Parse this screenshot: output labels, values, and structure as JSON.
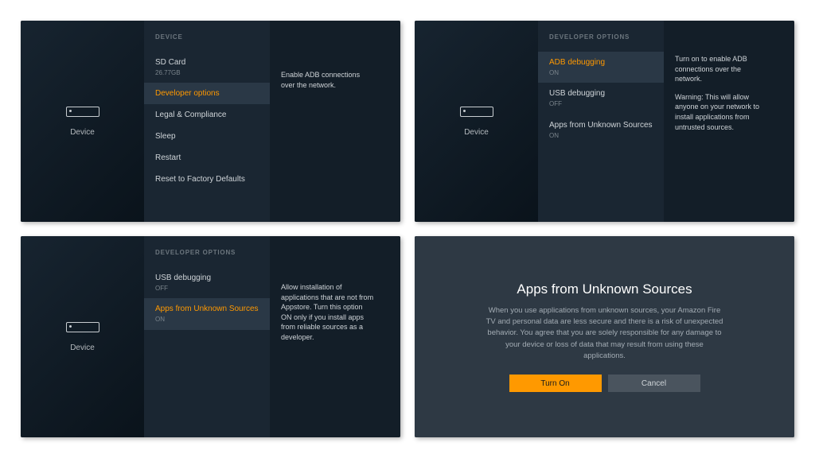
{
  "leftLabel": "Device",
  "s1": {
    "hdr": "DEVICE",
    "items": [
      {
        "label": "SD Card",
        "sub": "26.77GB",
        "sel": false
      },
      {
        "label": "Developer options",
        "sel": true
      },
      {
        "label": "Legal & Compliance",
        "sel": false
      },
      {
        "label": "Sleep",
        "sel": false
      },
      {
        "label": "Restart",
        "sel": false
      },
      {
        "label": "Reset to Factory Defaults",
        "sel": false
      }
    ],
    "desc": "Enable ADB connections over the network."
  },
  "s2": {
    "hdr": "DEVELOPER OPTIONS",
    "items": [
      {
        "label": "ADB debugging",
        "sub": "ON",
        "sel": true
      },
      {
        "label": "USB debugging",
        "sub": "OFF",
        "sel": false
      },
      {
        "label": "Apps from Unknown Sources",
        "sub": "ON",
        "sel": false
      }
    ],
    "desc": "Turn on to enable ADB connections over the network.",
    "warn": "Warning: This will allow anyone on your network to install applications from untrusted sources."
  },
  "s3": {
    "hdr": "DEVELOPER OPTIONS",
    "items": [
      {
        "label": "USB debugging",
        "sub": "OFF",
        "sel": false
      },
      {
        "label": "Apps from Unknown Sources",
        "sub": "ON",
        "sel": true
      }
    ],
    "desc": "Allow installation of applications that are not from Appstore. Turn this option ON only if you install apps from reliable sources as a developer."
  },
  "s4": {
    "title": "Apps from Unknown Sources",
    "body": "When you use applications from unknown sources, your Amazon Fire TV and personal data are less secure and there is a risk of unexpected behavior. You agree that you are solely responsible for any damage to your device or loss of data that may result from using these applications.",
    "turnOn": "Turn On",
    "cancel": "Cancel"
  }
}
